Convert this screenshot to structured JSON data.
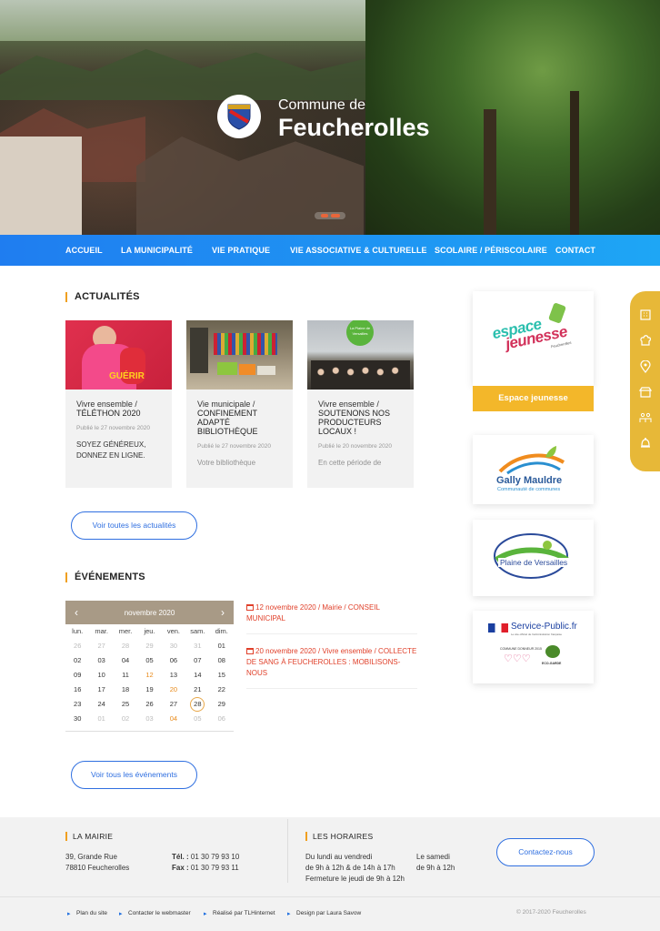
{
  "header": {
    "subtitle": "Commune de",
    "title": "Feucherolles"
  },
  "nav": [
    "ACCUEIL",
    "LA MUNICIPALITÉ",
    "VIE PRATIQUE",
    "VIE ASSOCIATIVE & CULTURELLE",
    "SCOLAIRE / PÉRISCOLAIRE",
    "CONTACT"
  ],
  "news": {
    "heading": "ACTUALITÉS",
    "cards": [
      {
        "category": "Vivre ensemble /",
        "title": "TÉLÉTHON 2020",
        "date": "Publié le 27 novembre 2020",
        "excerpt": "SOYEZ GÉNÉREUX, DONNEZ EN LIGNE.",
        "image_text": "GUÉRIR"
      },
      {
        "category": "Vie municipale /",
        "title": "CONFINEMENT ADAPTÉ BIBLIOTHÈQUE",
        "date": "Publié le 27 novembre 2020",
        "excerpt": "Votre bibliothèque"
      },
      {
        "category": "Vivre ensemble /",
        "title": "SOUTENONS NOS PRODUCTEURS LOCAUX !",
        "date": "Publié le 20 novembre 2020",
        "excerpt": "En cette période de",
        "image_text": "La Plaine de Versailles"
      }
    ],
    "more_button": "Voir toutes les actualités"
  },
  "events": {
    "heading": "ÉVÉNEMENTS",
    "calendar": {
      "month": "novembre 2020",
      "prev": "‹",
      "next": "›",
      "days": [
        "lun.",
        "mar.",
        "mer.",
        "jeu.",
        "ven.",
        "sam.",
        "dim."
      ],
      "weeks": [
        [
          {
            "d": "26",
            "s": "muted"
          },
          {
            "d": "27",
            "s": "muted"
          },
          {
            "d": "28",
            "s": "muted"
          },
          {
            "d": "29",
            "s": "muted"
          },
          {
            "d": "30",
            "s": "muted"
          },
          {
            "d": "31",
            "s": "muted"
          },
          {
            "d": "01",
            "s": ""
          }
        ],
        [
          {
            "d": "02",
            "s": ""
          },
          {
            "d": "03",
            "s": ""
          },
          {
            "d": "04",
            "s": ""
          },
          {
            "d": "05",
            "s": ""
          },
          {
            "d": "06",
            "s": ""
          },
          {
            "d": "07",
            "s": ""
          },
          {
            "d": "08",
            "s": ""
          }
        ],
        [
          {
            "d": "09",
            "s": ""
          },
          {
            "d": "10",
            "s": ""
          },
          {
            "d": "11",
            "s": ""
          },
          {
            "d": "12",
            "s": "ev"
          },
          {
            "d": "13",
            "s": ""
          },
          {
            "d": "14",
            "s": ""
          },
          {
            "d": "15",
            "s": ""
          }
        ],
        [
          {
            "d": "16",
            "s": ""
          },
          {
            "d": "17",
            "s": ""
          },
          {
            "d": "18",
            "s": ""
          },
          {
            "d": "19",
            "s": ""
          },
          {
            "d": "20",
            "s": "ev"
          },
          {
            "d": "21",
            "s": ""
          },
          {
            "d": "22",
            "s": ""
          }
        ],
        [
          {
            "d": "23",
            "s": ""
          },
          {
            "d": "24",
            "s": ""
          },
          {
            "d": "25",
            "s": ""
          },
          {
            "d": "26",
            "s": ""
          },
          {
            "d": "27",
            "s": ""
          },
          {
            "d": "28",
            "s": "today"
          },
          {
            "d": "29",
            "s": ""
          }
        ],
        [
          {
            "d": "30",
            "s": ""
          },
          {
            "d": "01",
            "s": "muted"
          },
          {
            "d": "02",
            "s": "muted"
          },
          {
            "d": "03",
            "s": "muted"
          },
          {
            "d": "04",
            "s": "ev"
          },
          {
            "d": "05",
            "s": "muted"
          },
          {
            "d": "06",
            "s": "muted"
          }
        ]
      ]
    },
    "items": [
      {
        "date": "12 novembre 2020",
        "category": " / Mairie / ",
        "title": "CONSEIL MUNICIPAL"
      },
      {
        "date": "20 novembre 2020",
        "category": " / Vivre ensemble / ",
        "title": "COLLECTE DE SANG À FEUCHEROLLES : MOBILISONS-NOUS"
      }
    ],
    "more_button": "Voir tous les événements"
  },
  "sidebar": {
    "espace_logo_line1": "espace",
    "espace_logo_line2": "jeunesse",
    "espace_logo_small": "Feucherolles",
    "espace_button": "Espace jeunesse",
    "gally_name": "Gally  Mauldre",
    "gally_sub": "Communauté de communes",
    "plaine_name": "Plaine de Versailles",
    "service_public": "Service-Public.fr",
    "service_public_sub": "Le site officiel de l'administration française",
    "commune_label": "COMMUNE DONNEUR 2015",
    "eco_label": "ECO-GARDE"
  },
  "quick_tabs": [
    "building-icon",
    "chef-hat-icon",
    "map-pin-icon",
    "store-icon",
    "people-icon",
    "bell-icon"
  ],
  "footer": {
    "mairie_title": "LA MAIRIE",
    "address1": "39, Grande Rue",
    "address2": "78810 Feucherolles",
    "tel_label": "Tél. :",
    "tel": " 01 30 79 93 10",
    "fax_label": "Fax :",
    "fax": " 01 30 79 93 11",
    "horaires_title": "LES HORAIRES",
    "week_label": "Du lundi au vendredi",
    "week_hours": "de 9h à 12h & de 14h à 17h",
    "thursday": "Fermeture le jeudi de 9h à 12h",
    "saturday_label": "Le samedi",
    "saturday_hours": "de 9h à 12h",
    "contact_button": "Contactez-nous",
    "links": [
      "Plan du site",
      "Contacter le webmaster",
      "Réalisé par TLHinternet",
      "Design par Laura Savow"
    ],
    "copyright": "© 2017-2020 Feucherolles"
  },
  "colors": {
    "nav_start": "#1f7df0",
    "nav_end": "#1ea6f5",
    "accent": "#f0a020",
    "event_red": "#e0402a",
    "button_blue": "#2f6fe0",
    "yellow": "#f3b72a"
  }
}
